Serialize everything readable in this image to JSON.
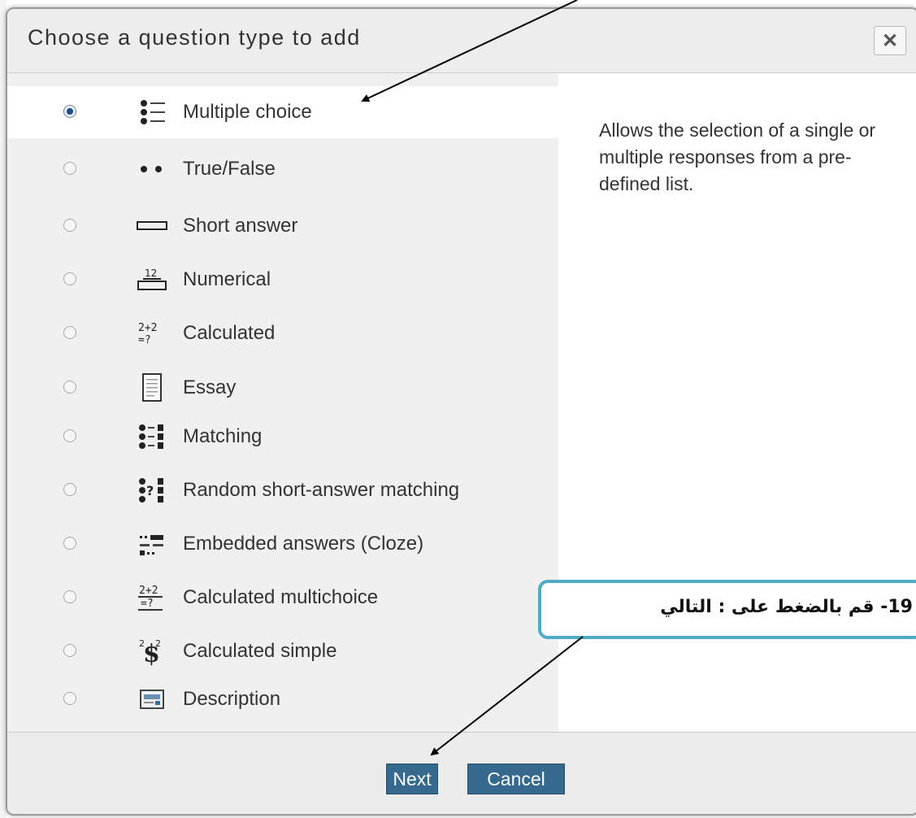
{
  "dialog": {
    "title": "Choose a question type to add",
    "close_label": "✕"
  },
  "question_types": [
    {
      "label": "Multiple choice",
      "icon": "multiple-choice-icon",
      "selected": true
    },
    {
      "label": "True/False",
      "icon": "true-false-icon",
      "selected": false
    },
    {
      "label": "Short answer",
      "icon": "short-answer-icon",
      "selected": false
    },
    {
      "label": "Numerical",
      "icon": "numerical-icon",
      "selected": false
    },
    {
      "label": "Calculated",
      "icon": "calculated-icon",
      "selected": false
    },
    {
      "label": "Essay",
      "icon": "essay-icon",
      "selected": false
    },
    {
      "label": "Matching",
      "icon": "matching-icon",
      "selected": false
    },
    {
      "label": "Random short-answer matching",
      "icon": "random-matching-icon",
      "selected": false
    },
    {
      "label": "Embedded answers (Cloze)",
      "icon": "cloze-icon",
      "selected": false
    },
    {
      "label": "Calculated multichoice",
      "icon": "calculated-multichoice-icon",
      "selected": false
    },
    {
      "label": "Calculated simple",
      "icon": "calculated-simple-icon",
      "selected": false
    },
    {
      "label": "Description",
      "icon": "description-icon",
      "selected": false
    }
  ],
  "description": "Allows the selection of a single or multiple responses from a pre-defined list.",
  "buttons": {
    "next": "Next",
    "cancel": "Cancel"
  },
  "callout": {
    "text": "19- قم بالضغط على : التالي"
  },
  "colors": {
    "button_bg": "#356a8e",
    "callout_border": "#4eacc6",
    "radio_checked": "#1f4c8f"
  }
}
